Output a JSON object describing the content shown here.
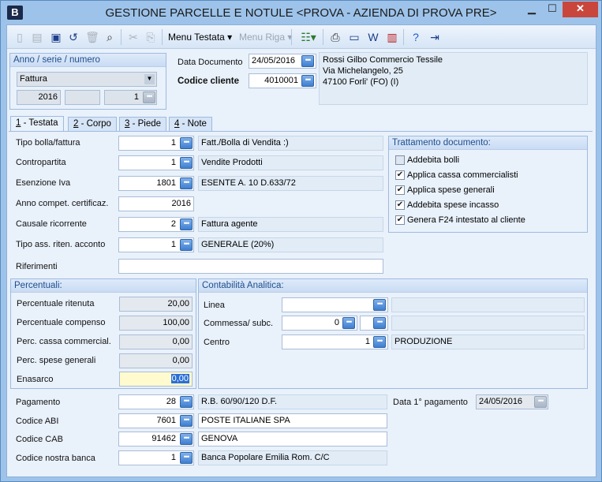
{
  "window": {
    "icon_letter": "B",
    "title": "GESTIONE PARCELLE E NOTULE <PROVA - AZIENDA DI PROVA PRE>"
  },
  "toolbar": {
    "menu_testata": "Menu Testata ▾",
    "menu_riga": "Menu Riga ▾"
  },
  "anno": {
    "header": "Anno / serie / numero",
    "select_value": "Fattura",
    "anno": "2016",
    "serie": "",
    "numero": "1"
  },
  "documento": {
    "data_label": "Data Documento",
    "data_value": "24/05/2016",
    "cliente_label": "Codice cliente",
    "cliente_value": "4010001",
    "address_line1": "Rossi Gilbo Commercio Tessile",
    "address_line2": "Via Michelangelo, 25",
    "address_line3": "47100 Forli'  (FO)    (I)"
  },
  "tabs": [
    {
      "key": "1",
      "label": " - Testata"
    },
    {
      "key": "2",
      "label": " - Corpo"
    },
    {
      "key": "3",
      "label": " - Piede"
    },
    {
      "key": "4",
      "label": " - Note"
    }
  ],
  "testata": {
    "tipo_bolla": {
      "label": "Tipo bolla/fattura",
      "value": "1",
      "desc": "Fatt./Bolla di Vendita :)"
    },
    "contropartita": {
      "label": "Contropartita",
      "value": "1",
      "desc": "Vendite Prodotti"
    },
    "esenzione": {
      "label": "Esenzione Iva",
      "value": "1801",
      "desc": "ESENTE A. 10 D.633/72"
    },
    "anno_compet": {
      "label": "Anno compet. certificaz.",
      "value": "2016"
    },
    "causale": {
      "label": "Causale ricorrente",
      "value": "2",
      "desc": "Fattura agente"
    },
    "tipo_ass": {
      "label": "Tipo ass. riten. acconto",
      "value": "1",
      "desc": "GENERALE (20%)"
    },
    "riferimenti": {
      "label": "Riferimenti",
      "value": ""
    }
  },
  "trattamento": {
    "header": "Trattamento documento:",
    "items": [
      {
        "label": "Addebita bolli",
        "checked": false
      },
      {
        "label": "Applica cassa commercialisti",
        "checked": true
      },
      {
        "label": "Applica spese generali",
        "checked": true
      },
      {
        "label": "Addebita spese incasso",
        "checked": true
      },
      {
        "label": "Genera F24 intestato al cliente",
        "checked": true
      }
    ]
  },
  "percentuali": {
    "header": "Percentuali:",
    "ritenuta": {
      "label": "Percentuale ritenuta",
      "value": "20,00"
    },
    "compenso": {
      "label": "Percentuale compenso",
      "value": "100,00"
    },
    "cassa": {
      "label": "Perc. cassa commercial.",
      "value": "0,00"
    },
    "spese": {
      "label": "Perc. spese generali",
      "value": "0,00"
    },
    "enasarco": {
      "label": "Enasarco",
      "value": "0,00"
    }
  },
  "analitica": {
    "header": "Contabilità Analitica:",
    "linea": {
      "label": "Linea",
      "value": "",
      "desc": ""
    },
    "commessa": {
      "label": "Commessa/ subc.",
      "value": "0",
      "sub": "",
      "desc": ""
    },
    "centro": {
      "label": "Centro",
      "value": "1",
      "desc": "PRODUZIONE"
    }
  },
  "pagamento": {
    "pagamento": {
      "label": "Pagamento",
      "value": "28",
      "desc": "R.B. 60/90/120 D.F."
    },
    "abi": {
      "label": "Codice ABI",
      "value": "7601",
      "desc": "POSTE ITALIANE SPA"
    },
    "cab": {
      "label": "Codice CAB",
      "value": "91462",
      "desc": "GENOVA"
    },
    "banca": {
      "label": "Codice nostra banca",
      "value": "1",
      "desc": "Banca Popolare Emilia Rom. C/C"
    },
    "data1_label": "Data 1° pagamento",
    "data1_value": "24/05/2016"
  }
}
